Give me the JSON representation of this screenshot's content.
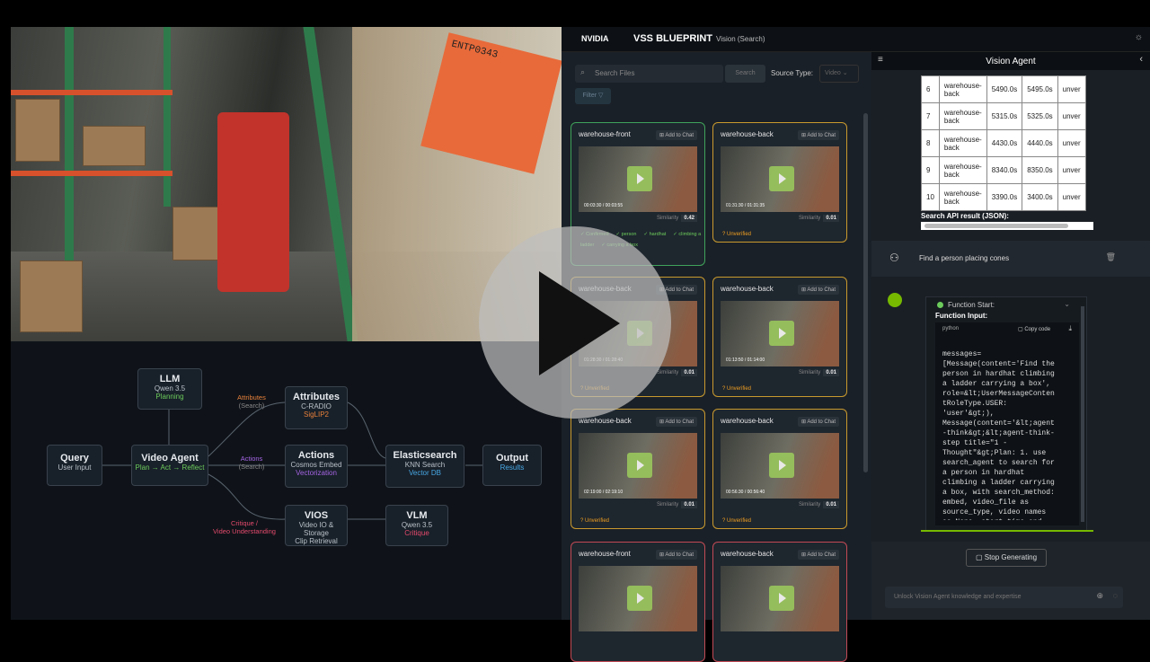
{
  "header": {
    "brand": "NVIDIA",
    "title": "VSS BLUEPRINT",
    "subtitle": "Vision (Search)"
  },
  "camera": {
    "label_text": "ENTP0343"
  },
  "diagram": {
    "query": {
      "title": "Query",
      "sub": "User Input"
    },
    "llm": {
      "title": "LLM",
      "sub": "Qwen 3.5",
      "tag": "Planning"
    },
    "agent": {
      "title": "Video Agent",
      "sub": "Plan → Act → Reflect"
    },
    "attributes": {
      "title": "Attributes",
      "sub": "C-RADIO",
      "tag": "SigLIP2"
    },
    "actions": {
      "title": "Actions",
      "sub": "Cosmos Embed",
      "tag": "Vectorization"
    },
    "vios": {
      "title": "VIOS",
      "sub": "Video IO & Storage",
      "tag": "Clip Retrieval"
    },
    "elastic": {
      "title": "Elasticsearch",
      "sub": "KNN Search",
      "tag": "Vector DB"
    },
    "vlm": {
      "title": "VLM",
      "sub": "Qwen 3.5",
      "tag": "Critique"
    },
    "output": {
      "title": "Output",
      "sub": "Results"
    },
    "edge_attr": "Attributes",
    "edge_attr_sub": "(Search)",
    "edge_act": "Actions",
    "edge_act_sub": "(Search)",
    "edge_crit": "Critique /",
    "edge_crit_sub": "Video Understanding"
  },
  "search": {
    "placeholder": "Search Files",
    "button": "Search",
    "source_label": "Source Type:",
    "source_value": "Video",
    "filter": "Filter"
  },
  "cards": [
    {
      "title": "warehouse-front",
      "add": "Add to Chat",
      "time": "00:03:30 / 00:03:55",
      "sim_label": "Similarity",
      "sim": "0.42",
      "status": "",
      "tags": [
        "✓ Confirmed",
        "✓ person",
        "✓ hardhat",
        "✓ climbing a ladder",
        "✓ carrying a box"
      ],
      "border": "#3fa35a"
    },
    {
      "title": "warehouse-back",
      "add": "Add to Chat",
      "time": "01:31:30 / 01:31:35",
      "sim_label": "Similarity",
      "sim": "0.01",
      "status": "? Unverified",
      "tags": [],
      "border": "#c99a2e"
    },
    {
      "title": "warehouse-back",
      "add": "Add to Chat",
      "time": "01:28:30 / 01:28:40",
      "sim_label": "Similarity",
      "sim": "0.01",
      "status": "? Unverified",
      "tags": [],
      "border": "#c99a2e"
    },
    {
      "title": "warehouse-back",
      "add": "Add to Chat",
      "time": "01:13:50 / 01:14:00",
      "sim_label": "Similarity",
      "sim": "0.01",
      "status": "? Unverified",
      "tags": [],
      "border": "#c99a2e"
    },
    {
      "title": "warehouse-back",
      "add": "Add to Chat",
      "time": "02:19:00 / 02:19:10",
      "sim_label": "Similarity",
      "sim": "0.01",
      "status": "? Unverified",
      "tags": [],
      "border": "#c99a2e"
    },
    {
      "title": "warehouse-back",
      "add": "Add to Chat",
      "time": "00:56:30 / 00:56:40",
      "sim_label": "Similarity",
      "sim": "0.01",
      "status": "? Unverified",
      "tags": [],
      "border": "#c99a2e"
    },
    {
      "title": "warehouse-front",
      "add": "Add to Chat",
      "time": "",
      "sim_label": "",
      "sim": "",
      "status": "",
      "tags": [],
      "border": "#c24a55"
    },
    {
      "title": "warehouse-back",
      "add": "Add to Chat",
      "time": "",
      "sim_label": "",
      "sim": "",
      "status": "",
      "tags": [],
      "border": "#c24a55"
    }
  ],
  "agent_panel": {
    "title": "Vision Agent",
    "rows": [
      [
        "6",
        "warehouse-back",
        "5490.0s",
        "5495.0s",
        "unver"
      ],
      [
        "7",
        "warehouse-back",
        "5315.0s",
        "5325.0s",
        "unver"
      ],
      [
        "8",
        "warehouse-back",
        "4430.0s",
        "4440.0s",
        "unver"
      ],
      [
        "9",
        "warehouse-back",
        "8340.0s",
        "8350.0s",
        "unver"
      ],
      [
        "10",
        "warehouse-back",
        "3390.0s",
        "3400.0s",
        "unver"
      ]
    ],
    "json_label": "Search API result (JSON):",
    "user_message": "Find a person placing cones",
    "function_start": "Function Start:",
    "function_input": "Function Input:",
    "lang": "python",
    "copy": "Copy code",
    "code_lines": [
      "messages=",
      "[Message(content='Find the",
      "person in hardhat climbing",
      "a ladder carrying a box',",
      "role=&lt;UserMessageConten",
      "tRoleType.USER:",
      "'user'&gt;),",
      "Message(content='&lt;agent",
      "-think&gt;&lt;agent-think-",
      "step title=\"1 -",
      "Thought\"&gt;Plan:  1. use",
      "search_agent to search for",
      "a person in hardhat",
      "climbing a ladder carrying",
      "a box, with search_method:",
      "embed, video_file as",
      "source_type, video names",
      "as None, start_time and"
    ],
    "stop": "Stop Generating",
    "input_placeholder": "Unlock Vision Agent knowledge and expertise"
  }
}
